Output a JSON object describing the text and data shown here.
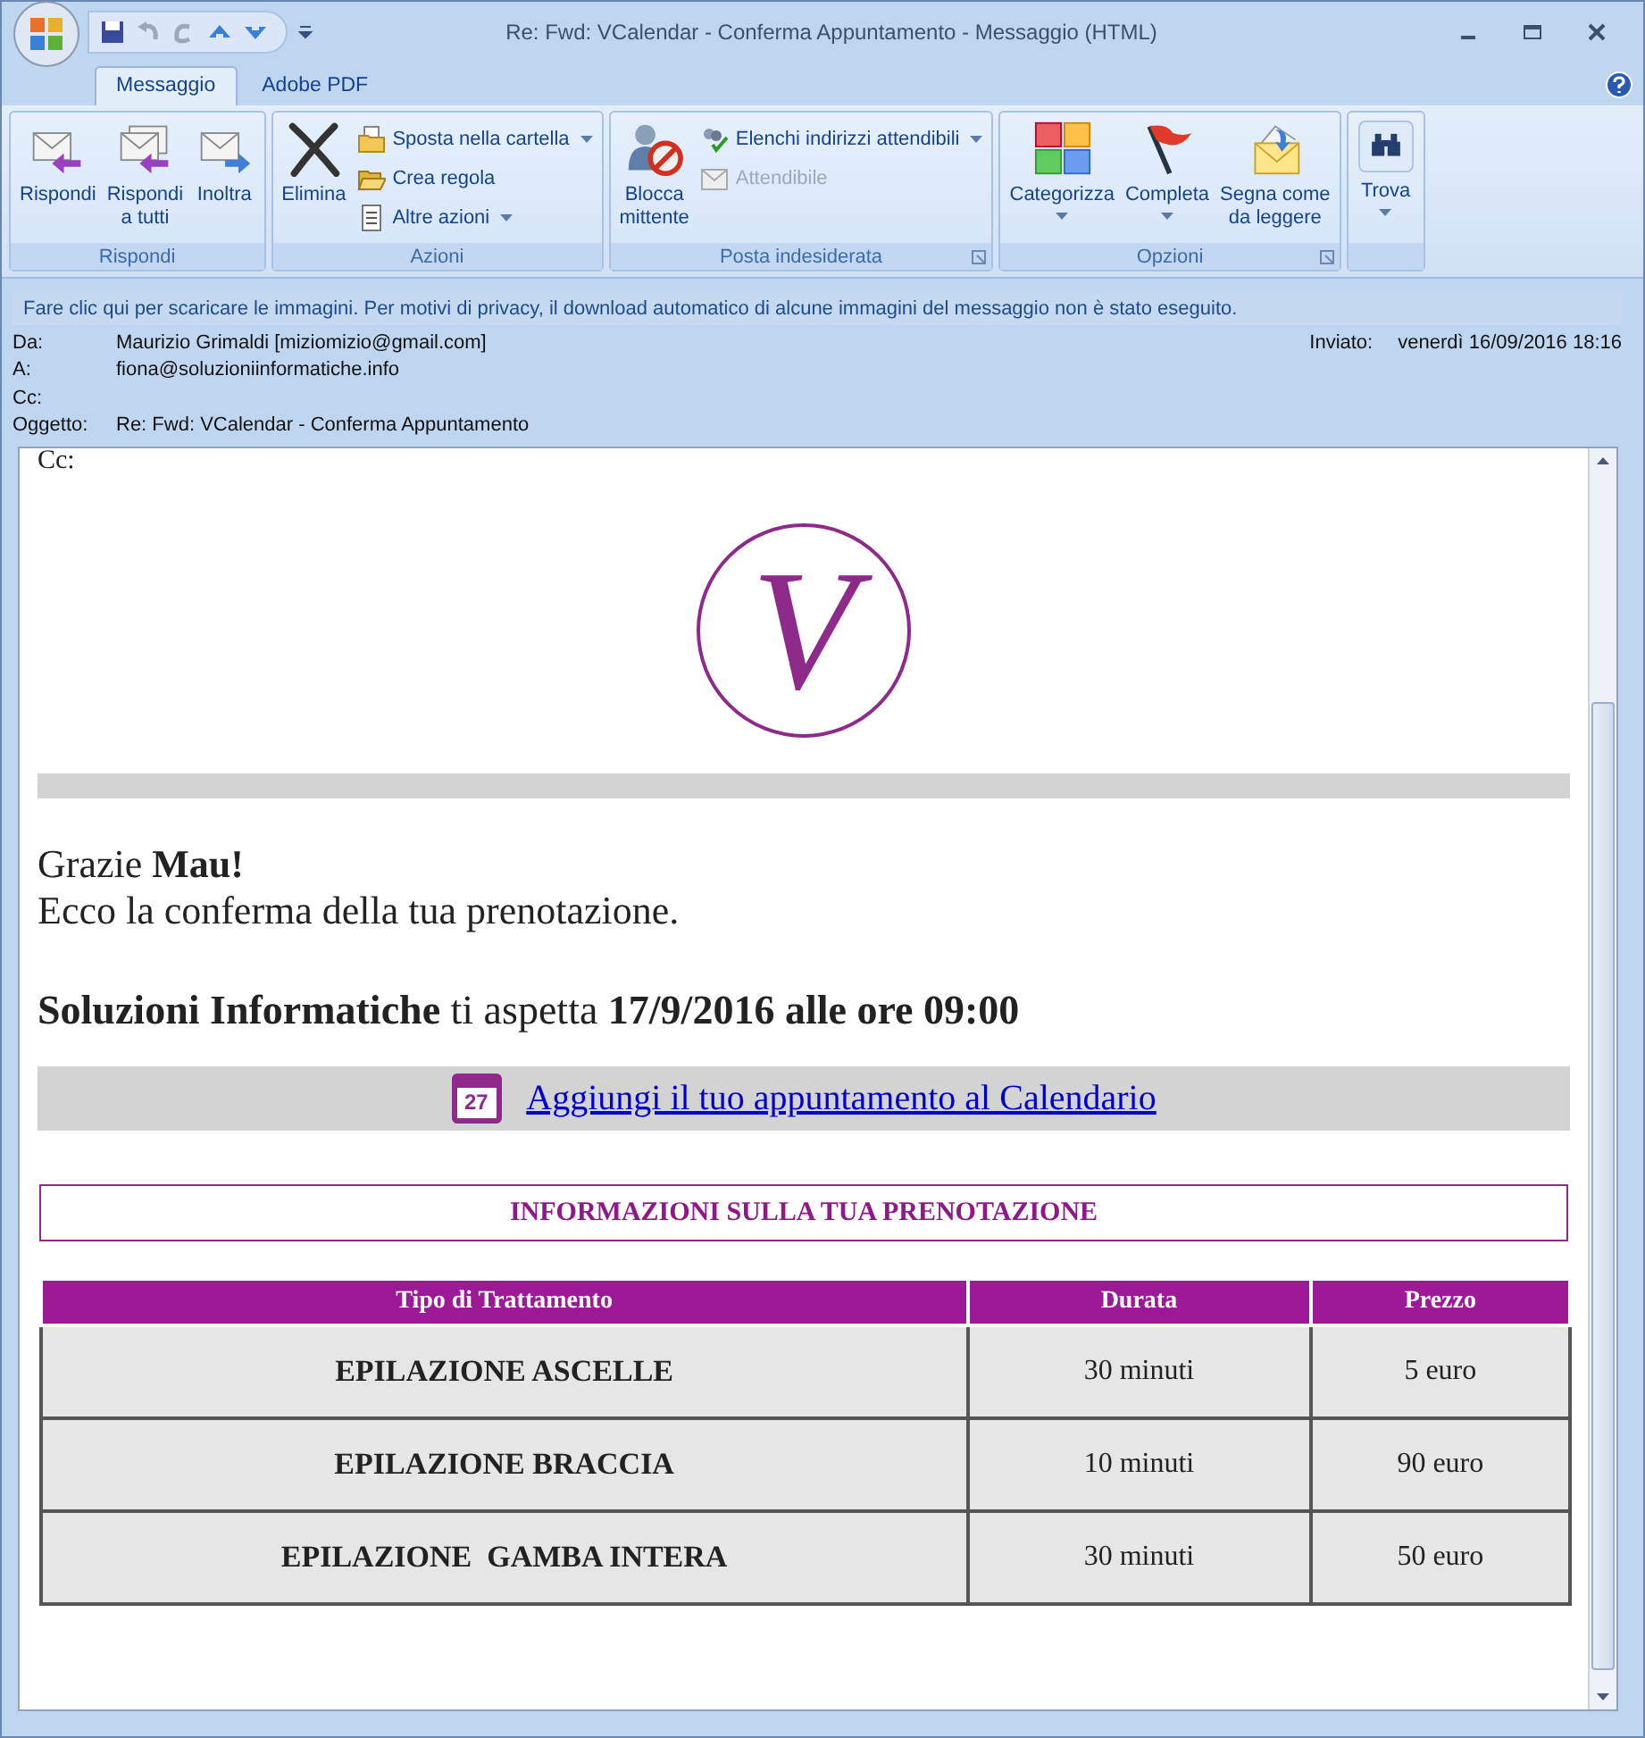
{
  "window": {
    "title": "Re: Fwd: VCalendar - Conferma Appuntamento - Messaggio (HTML)"
  },
  "tabs": [
    {
      "label": "Messaggio",
      "selected": true
    },
    {
      "label": "Adobe PDF",
      "selected": false
    }
  ],
  "ribbon": [
    {
      "label": "Rispondi",
      "buttons": [
        {
          "kind": "large",
          "lines": [
            "Rispondi"
          ]
        },
        {
          "kind": "large",
          "lines": [
            "Rispondi",
            "a tutti"
          ]
        },
        {
          "kind": "large",
          "lines": [
            "Inoltra"
          ]
        }
      ]
    },
    {
      "label": "Azioni",
      "buttons": [
        {
          "kind": "large",
          "lines": [
            "Elimina"
          ]
        },
        {
          "kind": "small",
          "lines": [
            "Sposta nella cartella"
          ],
          "dropdown": true
        },
        {
          "kind": "small",
          "lines": [
            "Crea regola"
          ]
        },
        {
          "kind": "small",
          "lines": [
            "Altre azioni"
          ],
          "dropdown": true
        }
      ]
    },
    {
      "label": "Posta indesiderata",
      "launcher": true,
      "buttons": [
        {
          "kind": "large",
          "lines": [
            "Blocca",
            "mittente"
          ]
        },
        {
          "kind": "small",
          "lines": [
            "Elenchi indirizzi attendibili"
          ],
          "dropdown": true
        },
        {
          "kind": "small",
          "lines": [
            "Attendibile"
          ],
          "disabled": true
        }
      ]
    },
    {
      "label": "Opzioni",
      "launcher": true,
      "buttons": [
        {
          "kind": "large",
          "lines": [
            "Categorizza"
          ],
          "dropdown": true
        },
        {
          "kind": "large",
          "lines": [
            "Completa"
          ],
          "dropdown": true
        },
        {
          "kind": "large",
          "lines": [
            "Segna come",
            "da leggere"
          ]
        }
      ]
    },
    {
      "buttons": [
        {
          "kind": "large",
          "lines": [
            "Trova"
          ],
          "dropdown": true
        }
      ]
    }
  ],
  "infobar": "Fare clic qui per scaricare le immagini. Per motivi di privacy, il download automatico di alcune immagini del messaggio non è stato eseguito.",
  "header": {
    "fields": [
      {
        "label": "Da:",
        "value": "Maurizio Grimaldi [miziomizio@gmail.com]"
      },
      {
        "label": "A:",
        "value": "fiona@soluzioniinformatiche.info"
      },
      {
        "label": "Cc:"
      },
      {
        "label": "Oggetto:",
        "value": "Re: Fwd: VCalendar - Conferma Appuntamento"
      }
    ],
    "sent_label": "Inviato:",
    "sent_value": "venerdì 16/09/2016 18:16"
  },
  "body": {
    "cc_fragment": "Cc:",
    "logo_letter": "V",
    "greeting": "Grazie **Mau!**",
    "confirmation": "Ecco la conferma della tua prenotazione.",
    "appointment": "**Soluzioni Informatiche** ti aspetta **17/9/2016 alle ore 09:00**",
    "calendar_day": "27",
    "calendar_link": "Aggiungi il tuo appuntamento al Calendario",
    "info_heading": "INFORMAZIONI SULLA TUA PRENOTAZIONE",
    "table": {
      "columns": [
        "Tipo di Trattamento",
        "Durata",
        "Prezzo"
      ],
      "rows": [
        [
          "EPILAZIONE ASCELLE",
          "30 minuti",
          "5 euro"
        ],
        [
          "EPILAZIONE BRACCIA",
          "10 minuti",
          "90 euro"
        ],
        [
          "EPILAZIONE  GAMBA INTERA",
          "30 minuti",
          "50 euro"
        ]
      ]
    }
  }
}
